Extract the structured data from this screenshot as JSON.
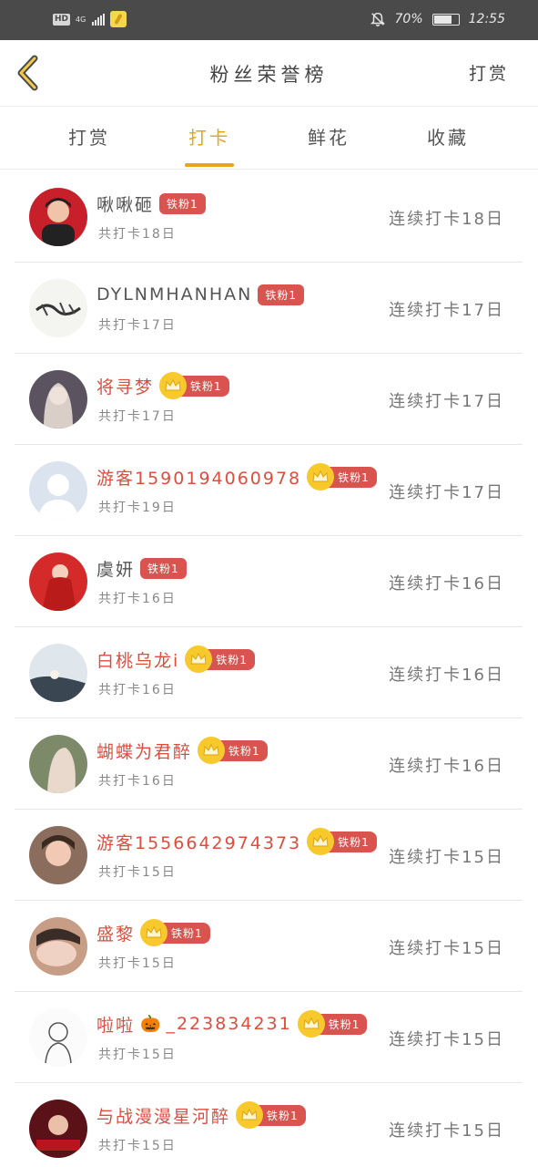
{
  "status_bar": {
    "hd": "HD",
    "network": "4G",
    "battery": "70%",
    "time": "12:55",
    "icons": [
      "signal-icon",
      "app-notification-icon",
      "bell-muted-icon",
      "battery-icon"
    ]
  },
  "header": {
    "title": "粉丝荣誉榜",
    "right_action": "打赏",
    "back_icon": "chevron-left-icon"
  },
  "tabs": [
    {
      "label": "打赏",
      "active": false
    },
    {
      "label": "打卡",
      "active": true
    },
    {
      "label": "鲜花",
      "active": false
    },
    {
      "label": "收藏",
      "active": false
    }
  ],
  "accent_color": "#e9a519",
  "badge_color": "#d9534f",
  "vip_name_color": "#dc4e3e",
  "rows": [
    {
      "name": "啾啾砸",
      "vip": false,
      "badge": "铁粉1",
      "total": "共打卡18日",
      "streak": "连续打卡18日",
      "avatar_icon": "avatar-photo-icon"
    },
    {
      "name": "DYLNMHANHAN",
      "vip": false,
      "badge": "铁粉1",
      "total": "共打卡17日",
      "streak": "连续打卡17日",
      "avatar_icon": "avatar-calligraphy-icon"
    },
    {
      "name": "将寻梦",
      "vip": true,
      "badge": "铁粉1",
      "total": "共打卡17日",
      "streak": "连续打卡17日",
      "avatar_icon": "avatar-illustration-icon"
    },
    {
      "name": "游客15901940609​78",
      "vip": true,
      "badge": "铁粉1",
      "total": "共打卡19日",
      "streak": "连续打卡17日",
      "avatar_icon": "default-avatar-icon"
    },
    {
      "name": "虞妍",
      "vip": false,
      "badge": "铁粉1",
      "total": "共打卡16日",
      "streak": "连续打卡16日",
      "avatar_icon": "avatar-photo-icon"
    },
    {
      "name": "白桃乌龙i",
      "vip": true,
      "badge": "铁粉1",
      "total": "共打卡16日",
      "streak": "连续打卡16日",
      "avatar_icon": "avatar-photo-icon"
    },
    {
      "name": "蝴蝶为君醉",
      "vip": true,
      "badge": "铁粉1",
      "total": "共打卡16日",
      "streak": "连续打卡16日",
      "avatar_icon": "avatar-illustration-icon"
    },
    {
      "name": "游客1556642974373",
      "vip": true,
      "badge": "铁粉1",
      "total": "共打卡15日",
      "streak": "连续打卡15日",
      "avatar_icon": "avatar-photo-icon"
    },
    {
      "name": "盛黎",
      "vip": true,
      "badge": "铁粉1",
      "total": "共打卡15日",
      "streak": "连续打卡15日",
      "avatar_icon": "avatar-photo-icon"
    },
    {
      "name": "啦啦",
      "emoji": "🎃",
      "name_suffix": "_223834231",
      "vip": true,
      "badge": "铁粉1",
      "total": "共打卡15日",
      "streak": "连续打卡15日",
      "avatar_icon": "avatar-sketch-icon"
    },
    {
      "name": "与战漫漫星河醉",
      "vip": true,
      "badge": "铁粉1",
      "total": "共打卡15日",
      "streak": "连续打卡15日",
      "avatar_icon": "avatar-poster-icon"
    }
  ]
}
